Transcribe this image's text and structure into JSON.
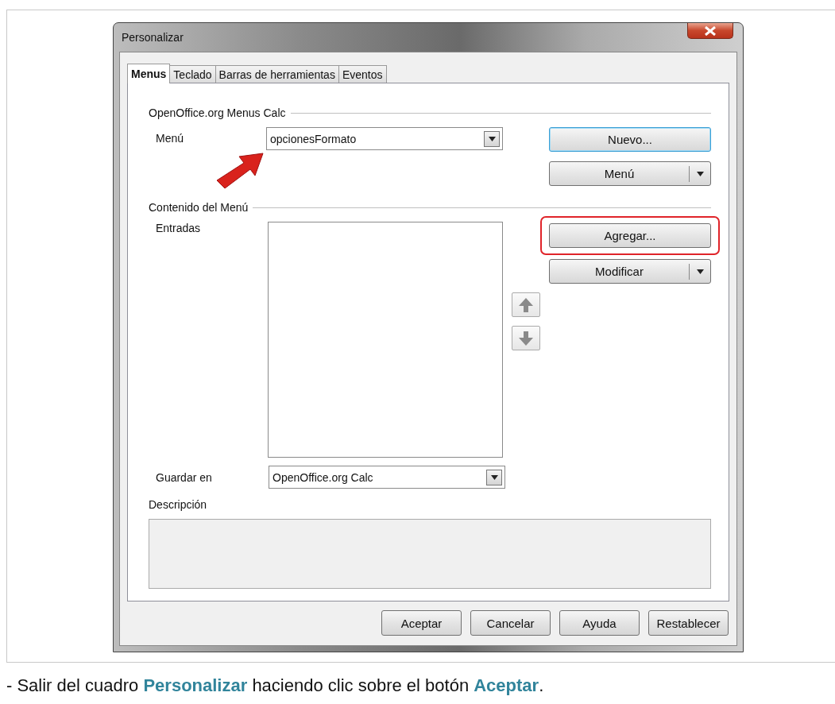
{
  "window": {
    "title": "Personalizar"
  },
  "tabs": [
    {
      "label": "Menus",
      "selected": true
    },
    {
      "label": "Teclado",
      "selected": false
    },
    {
      "label": "Barras de herramientas",
      "selected": false
    },
    {
      "label": "Eventos",
      "selected": false
    }
  ],
  "menu_section": {
    "heading": "OpenOffice.org Menus Calc",
    "menu_label": "Menú",
    "menu_value": "opcionesFormato",
    "buttons": [
      {
        "label": "Nuevo...",
        "kind": "plain",
        "focused": true
      },
      {
        "label": "Menú",
        "kind": "split",
        "focused": false
      }
    ]
  },
  "content_section": {
    "heading": "Contenido del Menú",
    "entries_label": "Entradas",
    "buttons": [
      {
        "label": "Agregar...",
        "kind": "plain",
        "highlighted": true
      },
      {
        "label": "Modificar",
        "kind": "split",
        "highlighted": false
      }
    ],
    "save_label": "Guardar en",
    "save_value": "OpenOffice.org Calc",
    "description_label": "Descripción"
  },
  "footer_buttons": [
    "Aceptar",
    "Cancelar",
    "Ayuda",
    "Restablecer"
  ],
  "caption": "- Salir del cuadro **Personalizar** haciendo clic sobre el botón **Aceptar**."
}
